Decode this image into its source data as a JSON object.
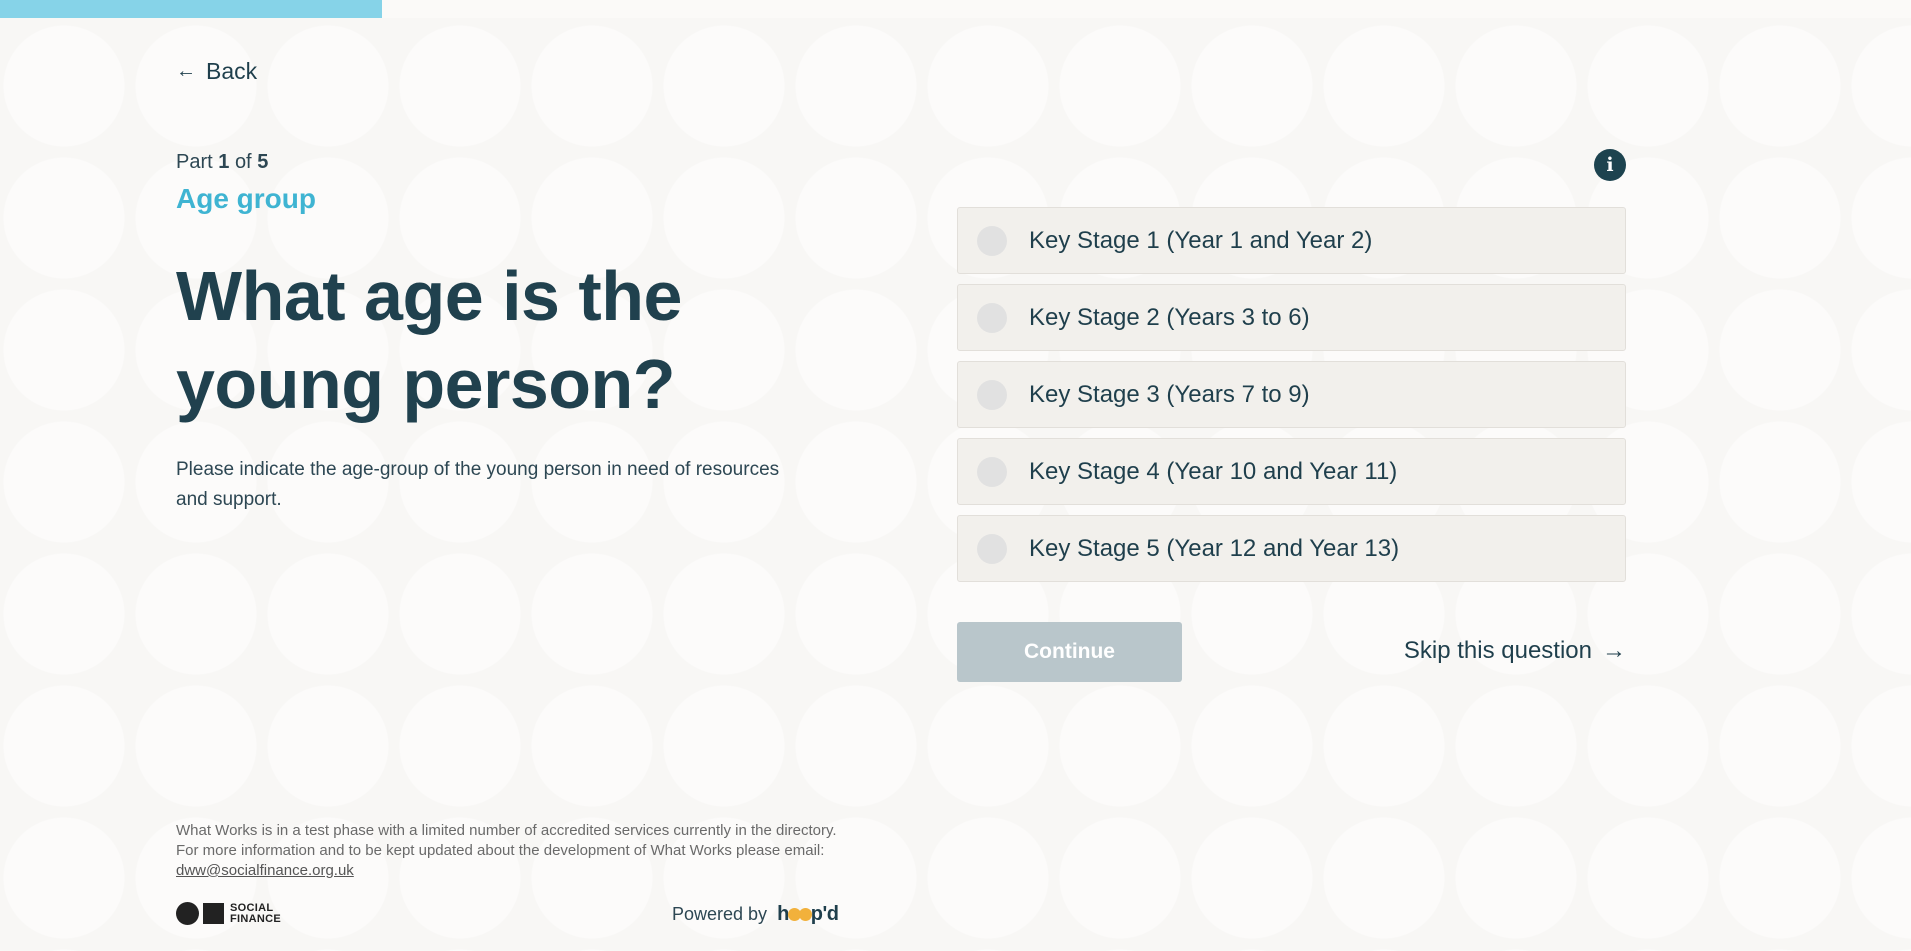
{
  "progress": {
    "fraction": 0.2,
    "color": "#86d3e8"
  },
  "nav": {
    "back_label": "Back"
  },
  "question": {
    "part_word": "Part",
    "part_current": "1",
    "part_of": "of",
    "part_total": "5",
    "section_title": "Age group",
    "heading": "What age is the young person?",
    "description": "Please indicate the age-group of the young person in need of resources and support."
  },
  "options": [
    {
      "label": "Key Stage 1 (Year 1 and Year 2)"
    },
    {
      "label": "Key Stage 2 (Years 3 to 6)"
    },
    {
      "label": "Key Stage 3 (Years 7 to 9)"
    },
    {
      "label": "Key Stage 4 (Year 10 and Year 11)"
    },
    {
      "label": "Key Stage 5 (Year 12 and Year 13)"
    }
  ],
  "actions": {
    "continue_label": "Continue",
    "skip_label": "Skip this question"
  },
  "footer": {
    "note": "What Works is in a test phase with a limited number of accredited services currently in the directory. For more information and to be kept updated about the development of What Works please email: ",
    "email": "dww@socialfinance.org.uk",
    "sf_logo_line1": "SOCIAL",
    "sf_logo_line2": "FINANCE",
    "powered_by": "Powered by",
    "hoopd_h": "h",
    "hoopd_tail": "p'd"
  },
  "colors": {
    "accent": "#3fb4d2",
    "heading": "#20414e",
    "button_disabled": "#b9c6cb",
    "hoopd_o1": "#f2b13b",
    "hoopd_o2": "#f2b13b"
  }
}
